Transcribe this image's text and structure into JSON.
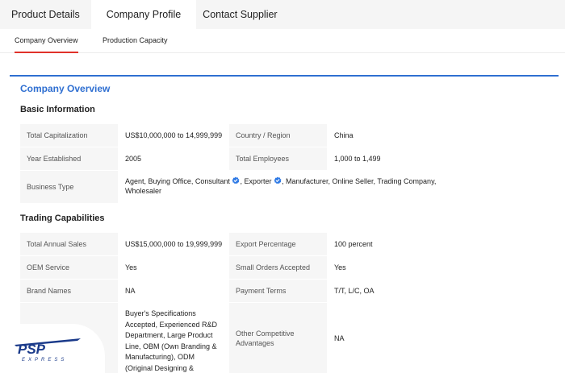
{
  "top_tabs": [
    "Product Details",
    "Company Profile",
    "Contact Supplier"
  ],
  "sub_tabs": [
    "Company Overview",
    "Production Capacity"
  ],
  "section_title": "Company Overview",
  "basic_info": {
    "title": "Basic Information",
    "total_capitalization_label": "Total Capitalization",
    "total_capitalization": "US$10,000,000 to 14,999,999",
    "country_label": "Country / Region",
    "country": "China",
    "year_label": "Year Established",
    "year": "2005",
    "employees_label": "Total Employees",
    "employees": "1,000 to 1,499",
    "business_type_label": "Business Type",
    "business_type_part1": "Agent, Buying Office, Consultant",
    "business_type_part2": ", Exporter",
    "business_type_part3": ", Manufacturer, Online Seller, Trading Company,",
    "business_type_part4": "Wholesaler"
  },
  "trading": {
    "title": "Trading Capabilities",
    "annual_sales_label": "Total Annual Sales",
    "annual_sales": "US$15,000,000 to 19,999,999",
    "export_pct_label": "Export Percentage",
    "export_pct": "100 percent",
    "oem_label": "OEM Service",
    "oem": "Yes",
    "small_orders_label": "Small Orders Accepted",
    "small_orders": "Yes",
    "brand_names_label": "Brand Names",
    "brand_names": "NA",
    "payment_terms_label": "Payment Terms",
    "payment_terms": "T/T, L/C, OA",
    "other_advantages_label": "Other Competitive Advantages",
    "other_advantages": "NA",
    "other_advantages_left": "Buyer's Specifications Accepted, Experienced R&D Department, Large Product Line, OBM (Own Branding & Manufacturing), ODM (Original Designing & Manufacturing),"
  },
  "logo": {
    "text": "PSP",
    "subtext": "EXPRESS",
    "color": "#1a3a8a"
  },
  "colors": {
    "accent_blue": "#2f6fd1",
    "active_underline": "#e0322a",
    "verified_blue": "#2f7ae5"
  }
}
